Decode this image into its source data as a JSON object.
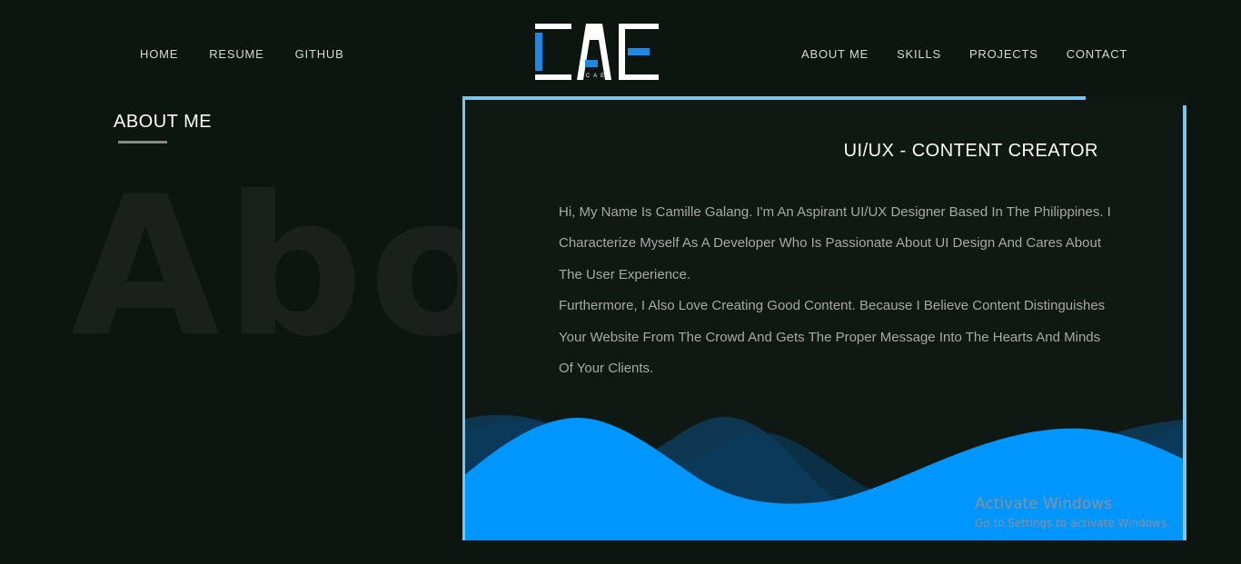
{
  "nav": {
    "left": [
      "HOME",
      "RESUME",
      "GITHUB"
    ],
    "right": [
      "ABOUT ME",
      "SKILLS",
      "PROJECTS",
      "CONTACT"
    ]
  },
  "logo": {
    "text": "CAE",
    "subtext": "CAE",
    "colors": {
      "primary": "#ffffff",
      "accent": "#1e88e5"
    }
  },
  "section": {
    "title": "ABOUT ME",
    "background_word": "About"
  },
  "card": {
    "heading": "UI/UX - CONTENT CREATOR",
    "paragraphs": [
      "Hi, My Name Is Camille Galang. I'm An Aspirant UI/UX Designer Based In The Philippines. I Characterize Myself As A Developer Who Is Passionate About UI Design And Cares About The User Experience.",
      "Furthermore, I Also Love Creating Good Content. Because I Believe Content Distinguishes Your Website From The Crowd And Gets The Proper Message Into The Hearts And Minds Of Your Clients."
    ],
    "colors": {
      "border": "#7cc4ea",
      "wave_front": "#0096ff",
      "wave_back": "#0b4d7a"
    }
  },
  "watermark": {
    "title": "Activate Windows",
    "subtitle": "Go to Settings to activate Windows."
  }
}
